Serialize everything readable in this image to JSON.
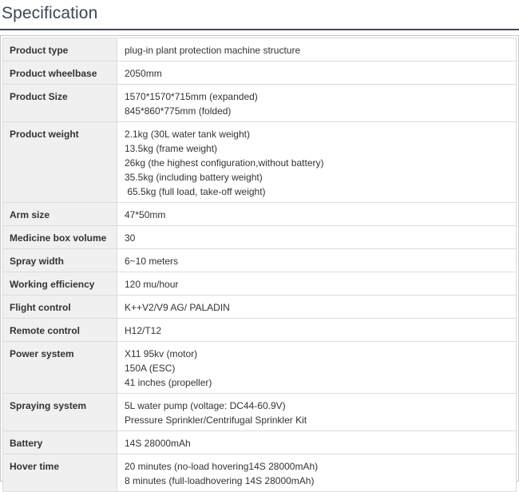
{
  "heading": "Specification",
  "rows": [
    {
      "label": "Product type",
      "values": [
        "plug-in plant protection machine structure"
      ]
    },
    {
      "label": "Product wheelbase",
      "values": [
        "2050mm"
      ]
    },
    {
      "label": "Product Size",
      "values": [
        "1570*1570*715mm (expanded)",
        "845*860*775mm (folded)"
      ]
    },
    {
      "label": "Product weight",
      "values": [
        "2.1kg (30L water tank weight)",
        "13.5kg (frame weight)",
        "26kg (the highest configuration,without battery)",
        "35.5kg (including battery weight)",
        " 65.5kg (full load, take-off weight)"
      ]
    },
    {
      "label": "Arm size",
      "values": [
        "47*50mm"
      ]
    },
    {
      "label": "Medicine box volume",
      "values": [
        "30"
      ]
    },
    {
      "label": "Spray width",
      "values": [
        "6~10 meters"
      ]
    },
    {
      "label": "Working efficiency",
      "values": [
        "120 mu/hour"
      ]
    },
    {
      "label": "Flight control",
      "values": [
        "K++V2/V9 AG/ PALADIN"
      ]
    },
    {
      "label": "Remote control",
      "values": [
        "H12/T12"
      ]
    },
    {
      "label": "Power system",
      "values": [
        "X11 95kv (motor)",
        "150A (ESC)",
        "41 inches (propeller)"
      ]
    },
    {
      "label": "Spraying system",
      "values": [
        "5L water pump (voltage: DC44-60.9V)",
        "Pressure Sprinkler/Centrifugal Sprinkler Kit"
      ]
    },
    {
      "label": "Battery",
      "values": [
        "14S 28000mAh"
      ]
    },
    {
      "label": "Hover time",
      "values": [
        "20 minutes (no-load hovering14S 28000mAh)",
        "8 minutes (full-loadhovering 14S 28000mAh)"
      ]
    }
  ]
}
